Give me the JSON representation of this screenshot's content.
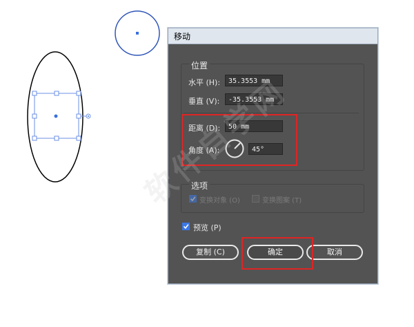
{
  "dialog": {
    "title": "移动",
    "position_group": {
      "label": "位置",
      "horizontal_label": "水平 (H):",
      "horizontal_value": "35.3553 mm",
      "vertical_label": "垂直 (V):",
      "vertical_value": "-35.3553 mm",
      "distance_label": "距离 (D):",
      "distance_value": "50 mm",
      "angle_label": "角度 (A):",
      "angle_value": "45°"
    },
    "options_group": {
      "label": "选项",
      "transform_objects_label": "变换对象 (O)",
      "transform_objects_checked": true,
      "transform_patterns_label": "变换图案 (T)",
      "transform_patterns_checked": false
    },
    "preview_label": "预览 (P)",
    "preview_checked": true,
    "copy_button": "复制 (C)",
    "ok_button": "确定",
    "cancel_button": "取消"
  },
  "colors": {
    "dialog_bg": "#535353",
    "field_bg": "#383838",
    "selection_blue": "#3b6fe0",
    "highlight_red": "#e02424"
  },
  "watermark": "软件自学网"
}
